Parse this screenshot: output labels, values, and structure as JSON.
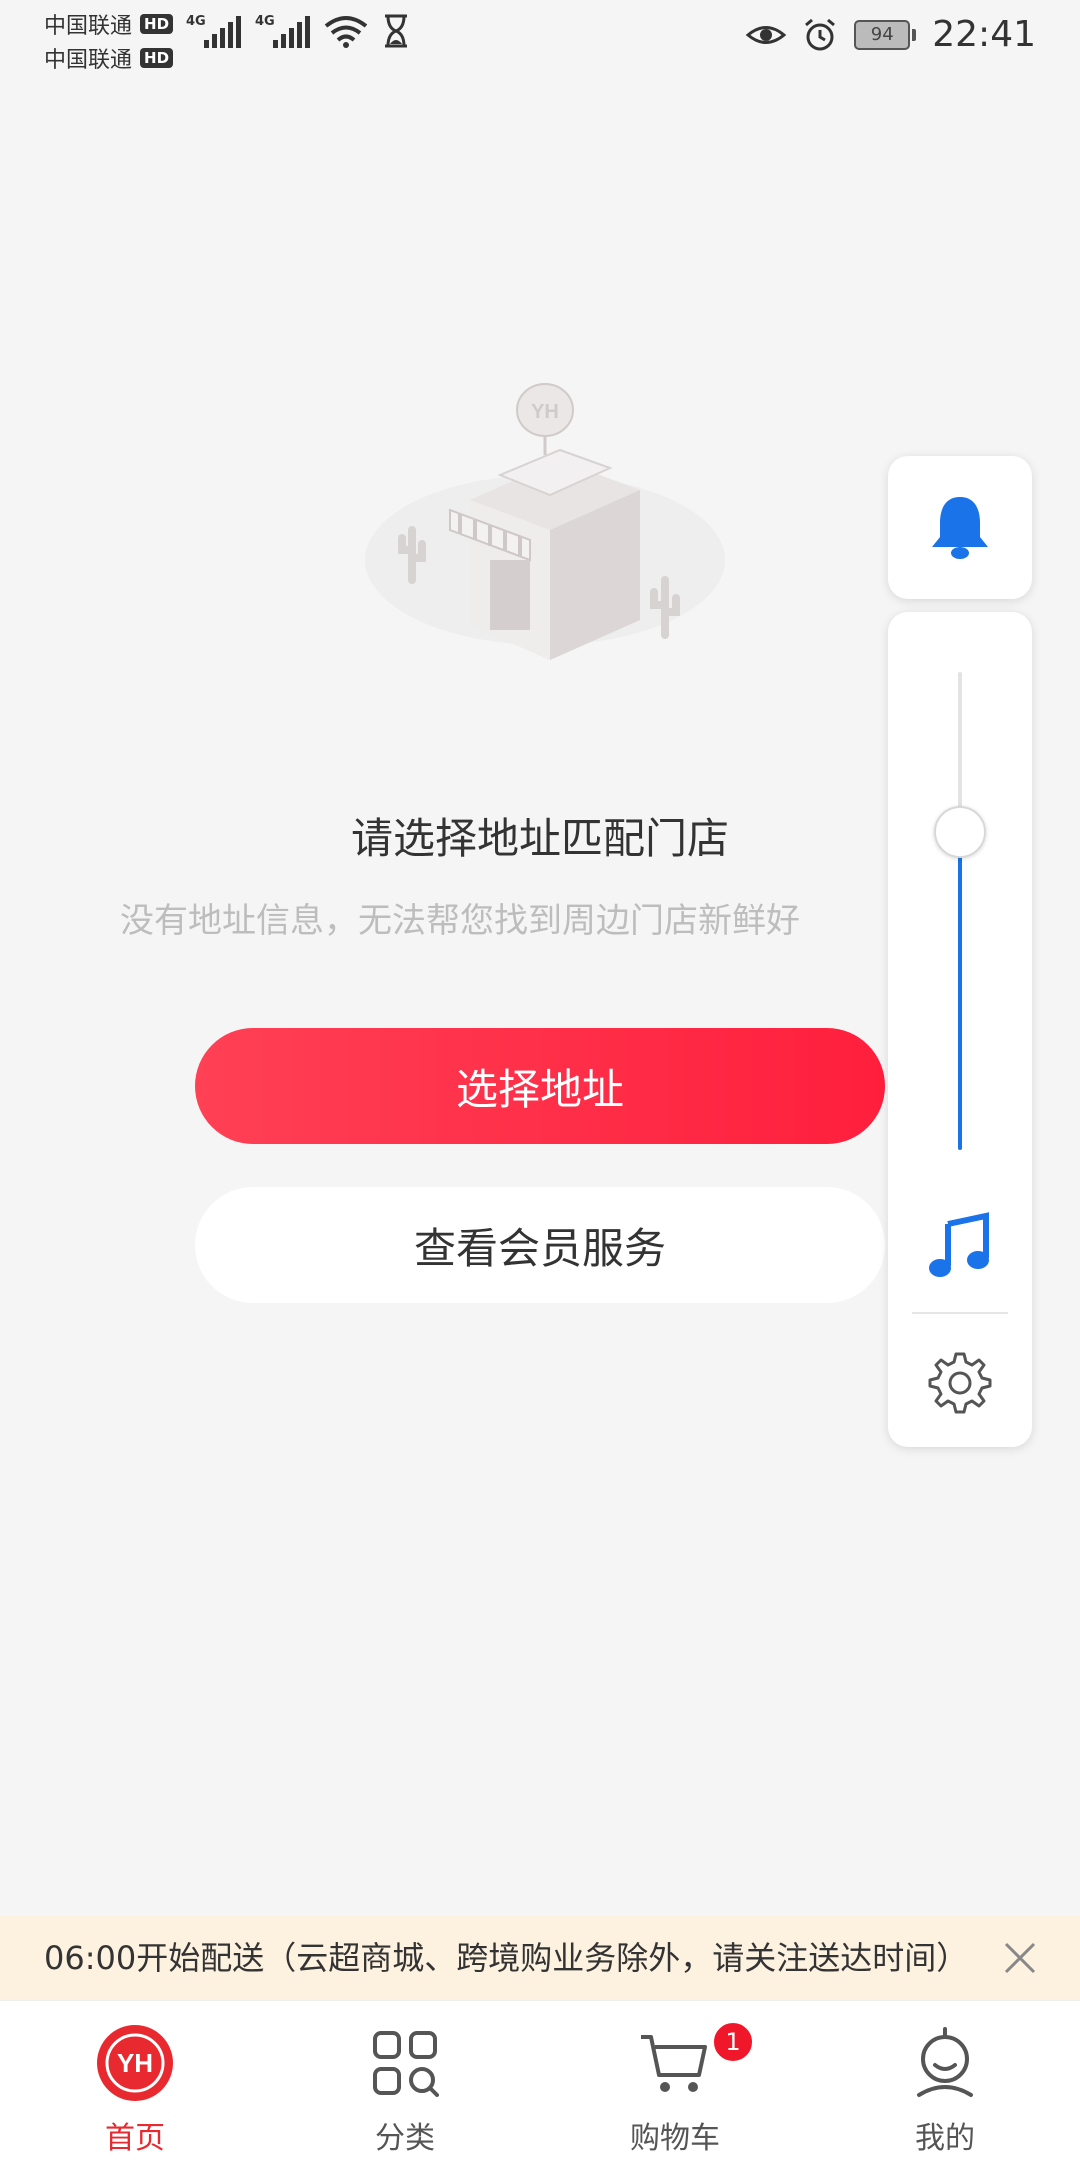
{
  "status_bar": {
    "carrier1": "中国联通",
    "carrier2": "中国联通",
    "hd_label": "HD",
    "network_tag": "4G",
    "battery_level": "94",
    "time": "22:41"
  },
  "main": {
    "title": "请选择地址匹配门店",
    "subtitle": "没有地址信息，无法帮您找到周边门店新鲜好",
    "primary_button": "选择地址",
    "secondary_button": "查看会员服务"
  },
  "volume_panel": {
    "level": 0.67,
    "accent_color": "#1a73e8"
  },
  "notice": {
    "text": "06:00开始配送（云超商城、跨境购业务除外，请关注送达时间）"
  },
  "tabbar": {
    "items": [
      {
        "label": "首页",
        "icon": "home-yh-icon",
        "active": true
      },
      {
        "label": "分类",
        "icon": "category-icon",
        "active": false
      },
      {
        "label": "购物车",
        "icon": "cart-icon",
        "active": false,
        "badge": "1"
      },
      {
        "label": "我的",
        "icon": "profile-icon",
        "active": false
      }
    ],
    "active_color": "#e8292f"
  }
}
